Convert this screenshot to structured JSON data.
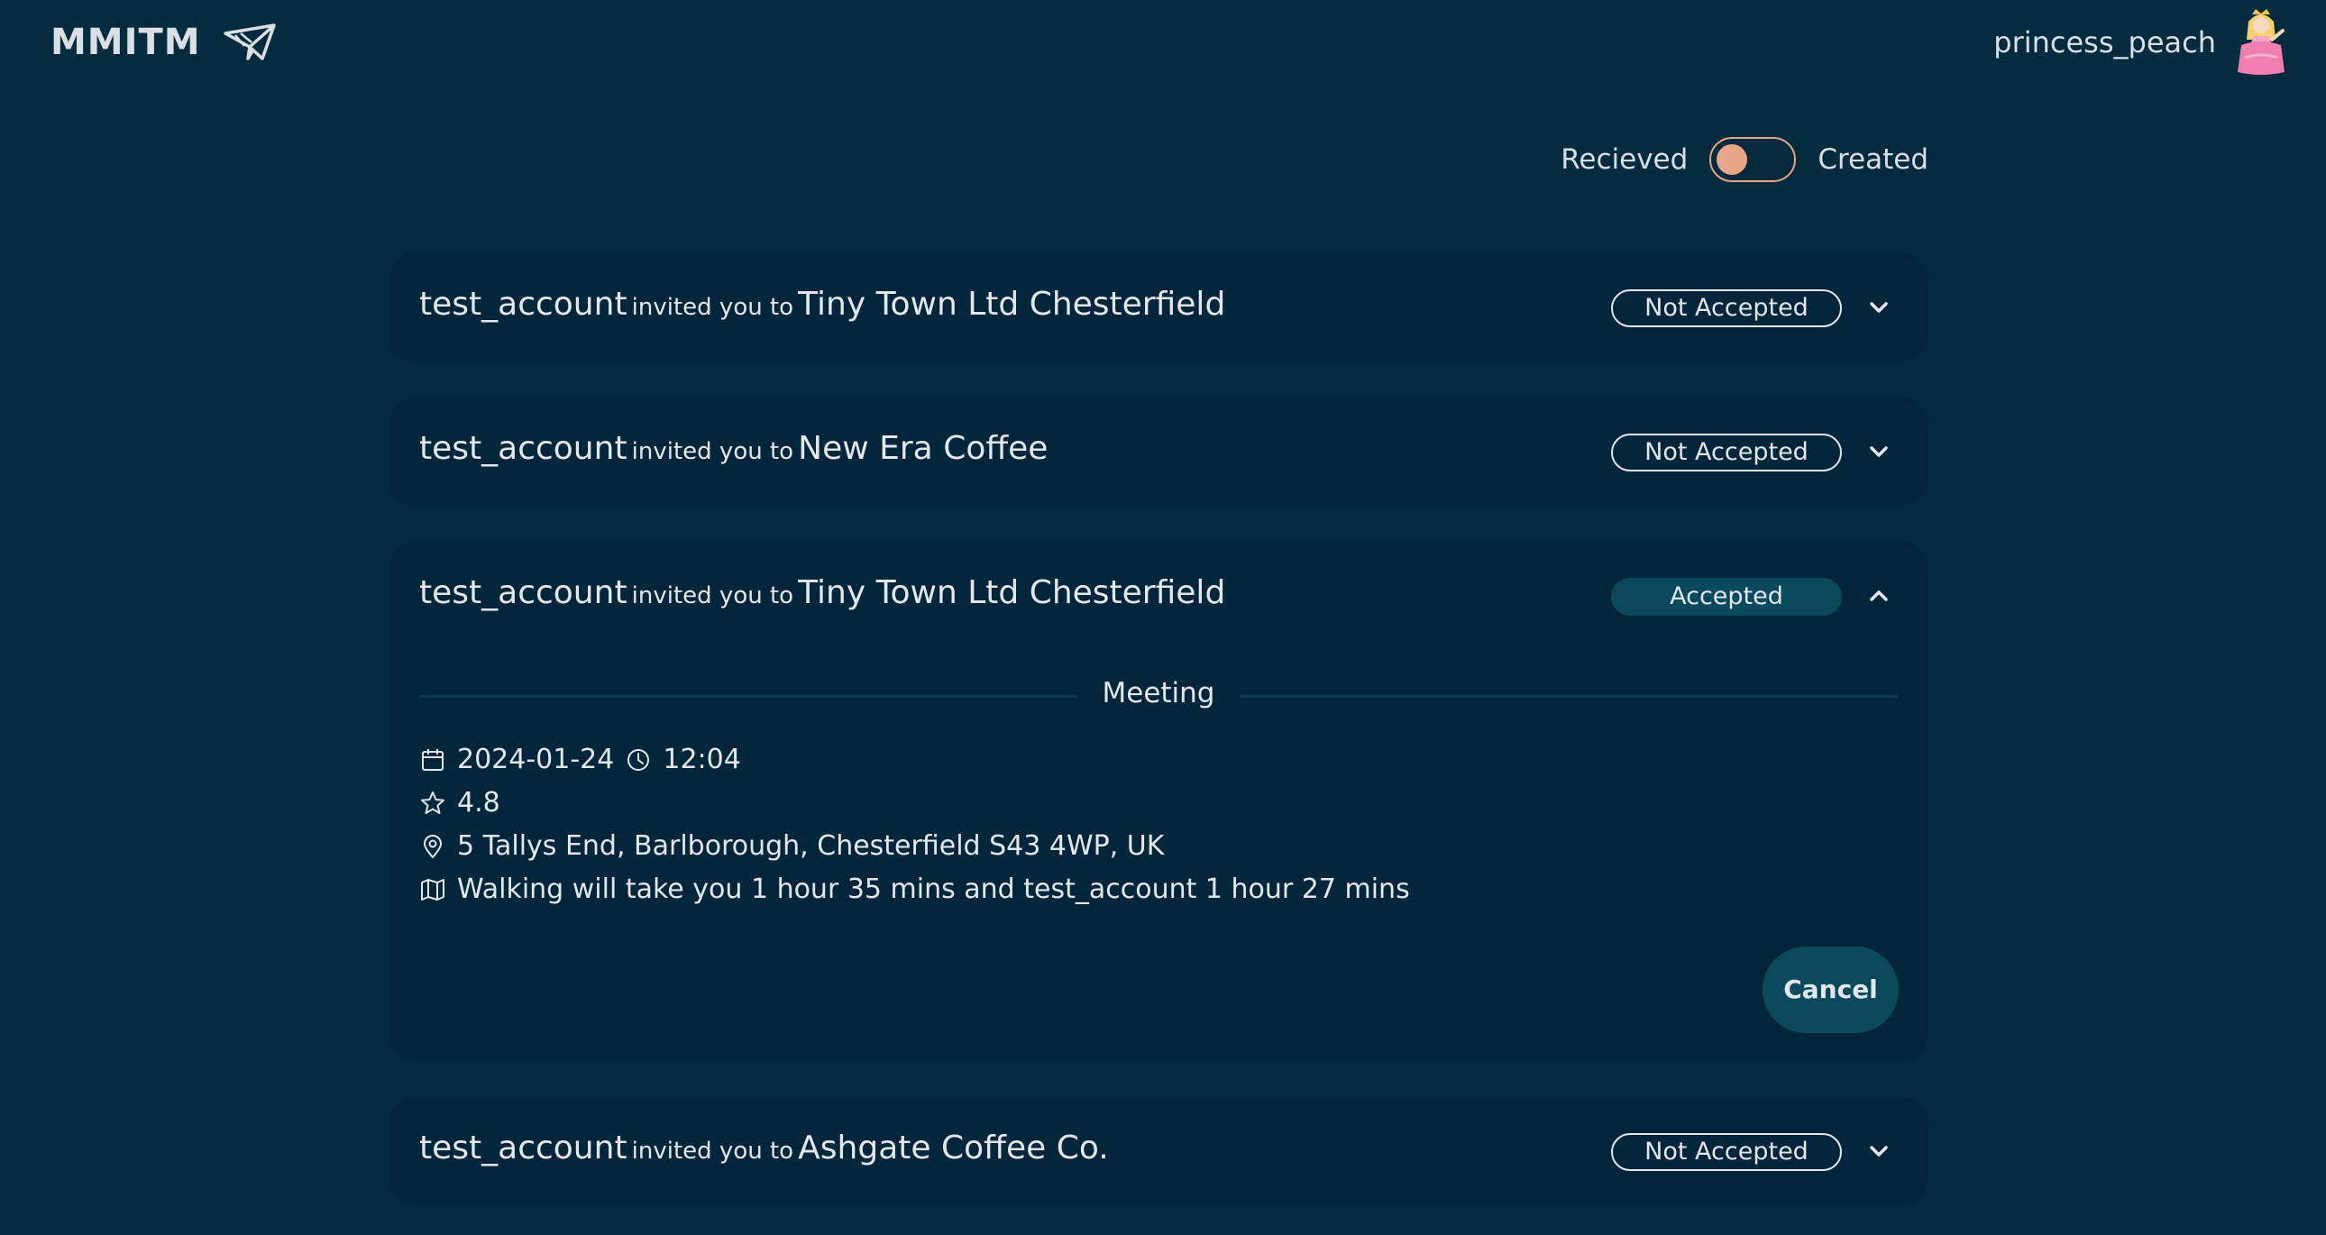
{
  "app": {
    "brand": "MMITM",
    "username": "princess_peach"
  },
  "view_toggle": {
    "left_label": "Recieved",
    "right_label": "Created",
    "selected": "Recieved"
  },
  "invite_phrase": "invited you to",
  "invitations": [
    {
      "from": "test_account",
      "place": "Tiny Town Ltd Chesterfield",
      "status": "Not Accepted",
      "expanded": false
    },
    {
      "from": "test_account",
      "place": "New Era Coffee",
      "status": "Not Accepted",
      "expanded": false
    },
    {
      "from": "test_account",
      "place": "Tiny Town Ltd Chesterfield",
      "status": "Accepted",
      "expanded": true,
      "section_label": "Meeting",
      "date": "2024-01-24",
      "time": "12:04",
      "rating": "4.8",
      "address": "5 Tallys End, Barlborough, Chesterfield S43 4WP, UK",
      "travel": "Walking will take you 1 hour 35 mins and test_account 1 hour 27 mins",
      "cancel_label": "Cancel"
    },
    {
      "from": "test_account",
      "place": "Ashgate Coffee Co.",
      "status": "Not Accepted",
      "expanded": false
    }
  ],
  "colors": {
    "background": "#042b3e",
    "card": "#03263a",
    "accent_toggle": "#e9a587",
    "accepted_badge": "#0b4a5c"
  }
}
